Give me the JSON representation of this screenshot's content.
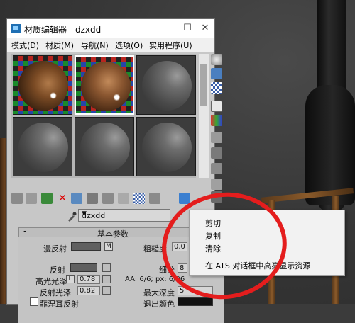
{
  "window": {
    "title": "材质编辑器 - dzxdd",
    "min_glyph": "—",
    "max_glyph": "☐",
    "close_glyph": "✕"
  },
  "menu": {
    "items": [
      "模式(D)",
      "材质(M)",
      "导航(N)",
      "选项(O)",
      "实用程序(U)"
    ]
  },
  "material": {
    "name": "dzxdd",
    "dropdown_glyph": "▼"
  },
  "rollout": {
    "collapse_glyph": "-",
    "title": "基本参数",
    "diffuse_label": "漫反射",
    "diffuse_map_btn": "M",
    "roughness_label": "粗糙度",
    "roughness_value": "0.0",
    "reflect_label": "反射",
    "subdivs_label": "细分",
    "subdivs_value": "8",
    "hilight_gloss_label": "高光光泽",
    "hilight_lock": "L",
    "hilight_gloss_value": "0.78",
    "aa_readout": "AA: 6/6; px: 6/96",
    "refl_gloss_label": "反射光泽",
    "refl_gloss_value": "0.82",
    "max_depth_label": "最大深度",
    "max_depth_value": "5",
    "fresnel_label": "菲涅耳反射",
    "exit_color_label": "退出颜色"
  },
  "context_menu": {
    "items": [
      "剪切",
      "复制",
      "清除",
      "在 ATS 对话框中高亮显示资源"
    ]
  },
  "colors": {
    "annotation": "#e41d1d",
    "window_bg": "#c7c7c7",
    "viewport_bg": "#3b3b3b"
  }
}
